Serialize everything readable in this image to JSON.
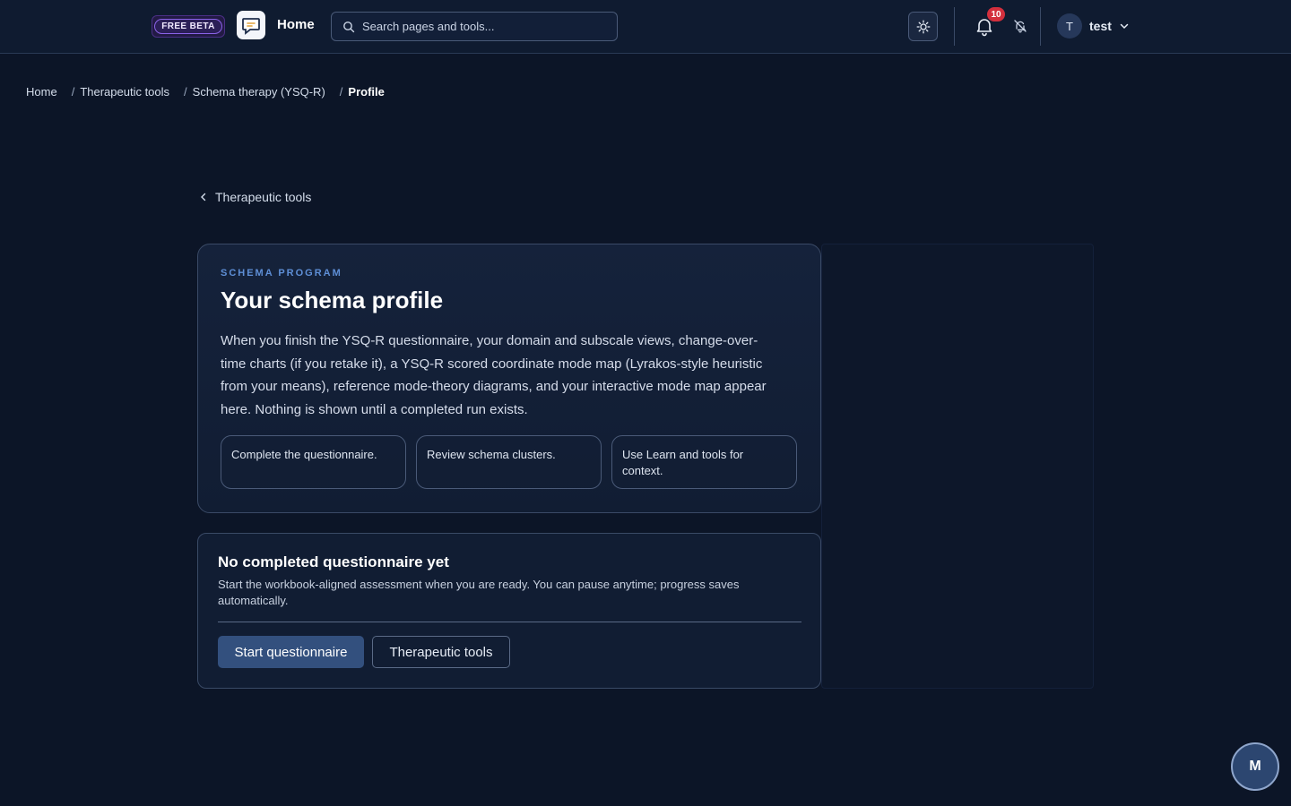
{
  "header": {
    "beta_label": "FREE BETA",
    "home_label": "Home",
    "search_placeholder": "Search pages and tools...",
    "notification_count": "10",
    "user": {
      "initial": "T",
      "name": "test"
    }
  },
  "breadcrumb": {
    "items": [
      "Home",
      "Therapeutic tools",
      "Schema therapy (YSQ-R)",
      "Profile"
    ],
    "separator": "/"
  },
  "back_link": "Therapeutic tools",
  "profile": {
    "eyebrow": "SCHEMA PROGRAM",
    "title": "Your schema profile",
    "description": "When you finish the YSQ-R questionnaire, your domain and subscale views, change-over-time charts (if you retake it), a YSQ-R scored coordinate mode map (Lyrakos-style heuristic from your means), reference mode-theory diagrams, and your interactive mode map appear here. Nothing is shown until a completed run exists.",
    "steps": [
      "Complete the questionnaire.",
      "Review schema clusters.",
      "Use Learn and tools for context."
    ]
  },
  "empty_state": {
    "title": "No completed questionnaire yet",
    "description": "Start the workbook-aligned assessment when you are ready. You can pause anytime; progress saves automatically.",
    "primary_button": "Start questionnaire",
    "secondary_button": "Therapeutic tools"
  },
  "fab_label": "M",
  "colors": {
    "background": "#0c1527",
    "accent": "#33507e",
    "eyebrow": "#5e8fd6",
    "badge": "#d32f3d",
    "beta": "#8b63e8"
  },
  "icons": [
    "chat-logo-icon",
    "search-icon",
    "sun-icon",
    "bell-icon",
    "bell-off-icon",
    "chevron-down-icon",
    "chevron-left-icon"
  ]
}
